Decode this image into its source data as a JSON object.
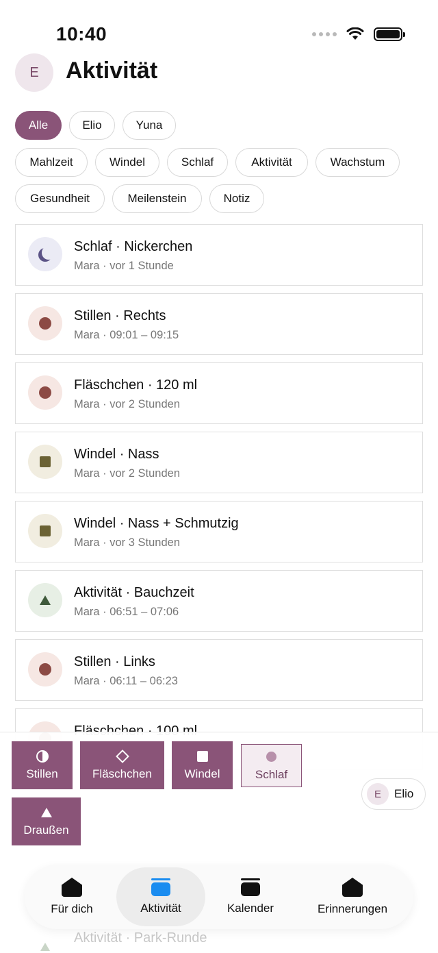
{
  "status_bar": {
    "time": "10:40"
  },
  "header": {
    "avatar_initial": "E",
    "title": "Aktivität"
  },
  "filters": {
    "children": [
      {
        "label": "Alle",
        "active": true
      },
      {
        "label": "Elio",
        "active": false
      },
      {
        "label": "Yuna",
        "active": false
      }
    ],
    "categories_row1": [
      "Mahlzeit",
      "Windel",
      "Schlaf",
      "Aktivität",
      "Wachstum"
    ],
    "categories_row2": [
      "Gesundheit",
      "Meilenstein",
      "Notiz"
    ]
  },
  "entries": [
    {
      "title": "Schlaf · Nickerchen",
      "subtitle": "Mara · vor 1 Stunde",
      "icon": "moon-icon",
      "icon_bg": "#ebebf5"
    },
    {
      "title": "Stillen · Rechts",
      "subtitle": "Mara · 09:01 – 09:15",
      "icon": "dot-icon",
      "icon_bg": "#f6e7e3"
    },
    {
      "title": "Fläschchen · 120 ml",
      "subtitle": "Mara · vor 2 Stunden",
      "icon": "dot-icon",
      "icon_bg": "#f6e7e3"
    },
    {
      "title": "Windel · Nass",
      "subtitle": "Mara · vor 2 Stunden",
      "icon": "square-icon",
      "icon_bg": "#f1ede0"
    },
    {
      "title": "Windel · Nass + Schmutzig",
      "subtitle": "Mara · vor 3 Stunden",
      "icon": "square-icon",
      "icon_bg": "#f1ede0"
    },
    {
      "title": "Aktivität · Bauchzeit",
      "subtitle": "Mara · 06:51 – 07:06",
      "icon": "triangle-icon",
      "icon_bg": "#e7efe5"
    },
    {
      "title": "Stillen · Links",
      "subtitle": "Mara · 06:11 – 06:23",
      "icon": "dot-icon",
      "icon_bg": "#f6e7e3"
    },
    {
      "title": "Fläschchen · 100 ml",
      "subtitle": "",
      "icon": "dot-icon",
      "icon_bg": "#f6e7e3"
    }
  ],
  "quick_actions": [
    {
      "label": "Stillen",
      "icon": "half-circle-icon"
    },
    {
      "label": "Fläschchen",
      "icon": "diamond-icon"
    },
    {
      "label": "Windel",
      "icon": "square-icon"
    },
    {
      "label": "Schlaf",
      "icon": "dot-icon"
    },
    {
      "label": "Draußen",
      "icon": "triangle-icon"
    }
  ],
  "child_switch": {
    "initial": "E",
    "name": "Elio"
  },
  "ghost_entry": {
    "title": "Aktivität · Park-Runde"
  },
  "tabs": [
    {
      "label": "Für dich",
      "icon": "house-icon",
      "active": false
    },
    {
      "label": "Aktivität",
      "icon": "list-icon",
      "active": true
    },
    {
      "label": "Kalender",
      "icon": "calendar-icon",
      "active": false
    },
    {
      "label": "Erinnerungen",
      "icon": "bell-icon",
      "active": false
    }
  ],
  "colors": {
    "accent": "#8a5478",
    "active_tab_icon": "#1a8cf0"
  }
}
